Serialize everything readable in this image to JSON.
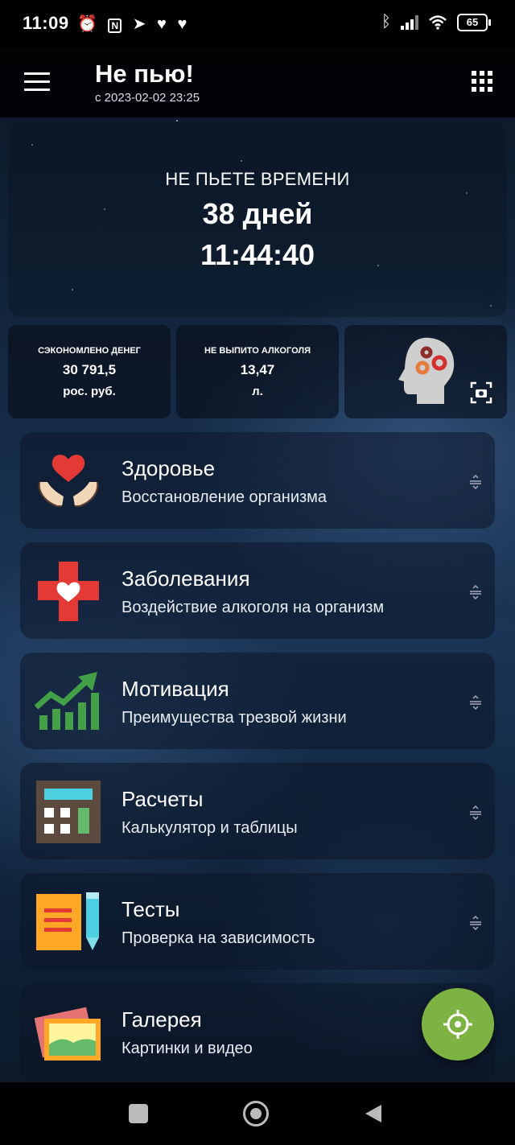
{
  "status_bar": {
    "time": "11:09",
    "battery": "65",
    "left_icons": [
      "alarm-icon",
      "nfc-icon",
      "telegram-icon",
      "vk-icon",
      "vk-icon"
    ],
    "right_icons": [
      "bluetooth-icon",
      "signal-icon",
      "wifi-icon",
      "battery-icon"
    ]
  },
  "app_bar": {
    "title": "Не пью!",
    "subtitle": "с 2023-02-02 23:25"
  },
  "timer": {
    "label": "НЕ ПЬЕТЕ ВРЕМЕНИ",
    "days": "38 дней",
    "clock": "11:44:40"
  },
  "stats": [
    {
      "title": "СЭКОНОМЛЕНО ДЕНЕГ",
      "value": "30 791,5",
      "unit": "рос. руб."
    },
    {
      "title": "НЕ ВЫПИТО АЛКОГОЛЯ",
      "value": "13,47",
      "unit": "л."
    }
  ],
  "menu": [
    {
      "title": "Здоровье",
      "subtitle": "Восстановление организма",
      "icon": "heart-hands-icon"
    },
    {
      "title": "Заболевания",
      "subtitle": "Воздействие алкоголя на организм",
      "icon": "medical-cross-icon"
    },
    {
      "title": "Мотивация",
      "subtitle": "Преимущества трезвой жизни",
      "icon": "growth-chart-icon"
    },
    {
      "title": "Расчеты",
      "subtitle": "Калькулятор и таблицы",
      "icon": "calculator-icon"
    },
    {
      "title": "Тесты",
      "subtitle": "Проверка на зависимость",
      "icon": "notepad-pencil-icon"
    },
    {
      "title": "Галерея",
      "subtitle": "Картинки и видео",
      "icon": "photo-gallery-icon"
    }
  ],
  "colors": {
    "fab": "#7cb342",
    "heart": "#e53935",
    "cross": "#e53935",
    "chart": "#43a047"
  }
}
